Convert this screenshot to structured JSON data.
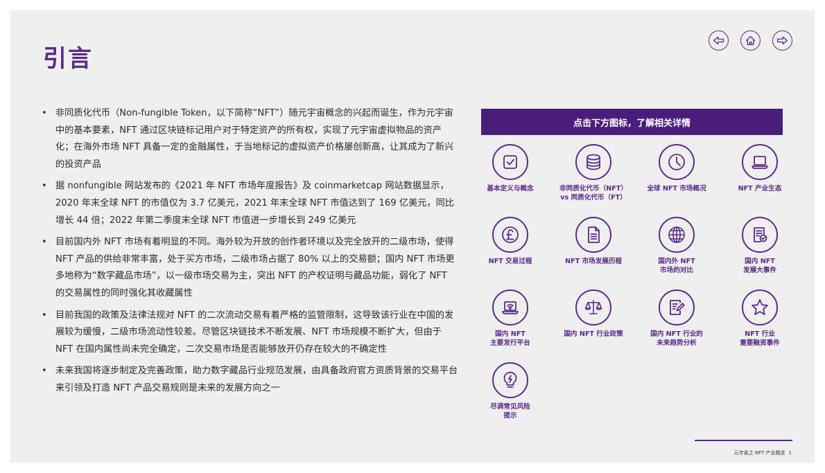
{
  "title": "引言",
  "nav": {
    "prev_icon": "arrow-left-icon",
    "home_icon": "home-icon",
    "next_icon": "arrow-right-icon"
  },
  "bullets": [
    "非同质化代币（Non-fungible Token，以下简称“NFT”）随元宇宙概念的兴起而诞生，作为元宇宙中的基本要素，NFT 通过区块链标记用户对于特定资产的所有权，实现了元宇宙虚拟物品的资产化；在海外市场 NFT 具备一定的金融属性，于当地标记的虚拟资产价格屡创新高，让其成为了新兴的投资产品",
    "据 nonfungible 网站发布的《2021 年 NFT 市场年度报告》及 coinmarketcap 网站数据显示，2020 年末全球 NFT 的市值仅为 3.7 亿美元，2021 年末全球 NFT 市值达到了 169 亿美元，同比增长 44 倍；2022 年第二季度末全球 NFT 市值进一步增长到 249 亿美元",
    "目前国内外 NFT 市场有着明显的不同。海外较为开放的创作者环境以及完全放开的二级市场，使得 NFT 产品的供给非常丰富，处于买方市场，二级市场占据了 80% 以上的交易额；国内 NFT 市场更多地称为“数字藏品市场”，以一级市场交易为主，突出 NFT 的产权证明与藏品功能，弱化了 NFT 的交易属性的同时强化其收藏属性",
    "目前我国的政策及法律法规对 NFT 的二次流动交易有着严格的监管限制，这导致该行业在中国的发展较为缓慢，二级市场流动性较差。尽管区块链技术不断发展、NFT 市场规模不断扩大，但由于 NFT 在国内属性尚未完全确定，二次交易市场是否能够放开仍存在较大的不确定性",
    "未来我国将逐步制定及完善政策，助力数字藏品行业规范发展，由具备政府官方资质背景的交易平台来引领及打造 NFT 产品交易规则是未来的发展方向之一"
  ],
  "panel": {
    "header": "点击下方图标，了解相关详情",
    "items": [
      {
        "label": "基本定义与概念",
        "icon": "checkbox-icon"
      },
      {
        "label": "非同质化代币（NFT）\nvs 同质化代币（FT）",
        "icon": "coin-stack-icon"
      },
      {
        "label": "全球 NFT 市场概况",
        "icon": "clock-icon"
      },
      {
        "label": "NFT 产业生态",
        "icon": "laptop-icon"
      },
      {
        "label": "NFT 交易过程",
        "icon": "pound-coin-icon"
      },
      {
        "label": "NFT 市场发展历程",
        "icon": "document-icon"
      },
      {
        "label": "国内外 NFT\n市场的对比",
        "icon": "globe-icon"
      },
      {
        "label": "国内 NFT\n发展大事件",
        "icon": "certificate-icon"
      },
      {
        "label": "国内 NFT\n主要发行平台",
        "icon": "wifi-laptop-icon"
      },
      {
        "label": "国内 NFT 行业政策",
        "icon": "scales-icon"
      },
      {
        "label": "国内 NFT 行业的\n未来趋势分析",
        "icon": "edit-document-icon"
      },
      {
        "label": "NFT 行业\n重要融资事件",
        "icon": "star-icon"
      },
      {
        "label": "尽调常见风险\n提示",
        "icon": "lightbulb-icon"
      }
    ]
  },
  "footer": {
    "text": "元宇宙之 NFT 产业概览",
    "page": "1"
  }
}
